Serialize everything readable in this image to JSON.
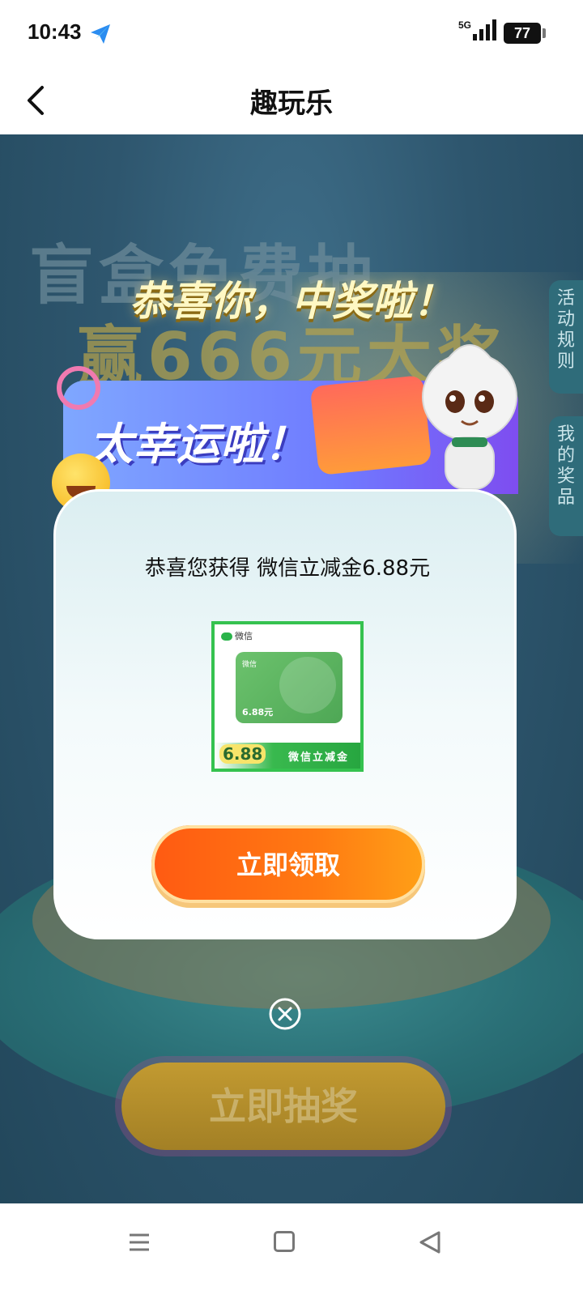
{
  "status_bar": {
    "time": "10:43",
    "network": "5G",
    "battery": "77"
  },
  "header": {
    "title": "趣玩乐"
  },
  "background": {
    "banner_line1": "盲盒免费抽",
    "banner_line2": "赢666元大奖",
    "side_tab_rules": "活动规则",
    "side_tab_prizes": "我的奖品",
    "draw_button": "立即抽奖"
  },
  "popup": {
    "congrats_heading": "恭喜你，中奖啦！",
    "lucky_text": "太幸运啦！",
    "prize_text": "恭喜您获得 微信立减金6.88元",
    "card": {
      "brand": "微信",
      "inner_brand": "微信",
      "inner_amount": "6.88元",
      "amount": "6.88",
      "label": "微信立减金"
    },
    "claim_button": "立即领取"
  }
}
